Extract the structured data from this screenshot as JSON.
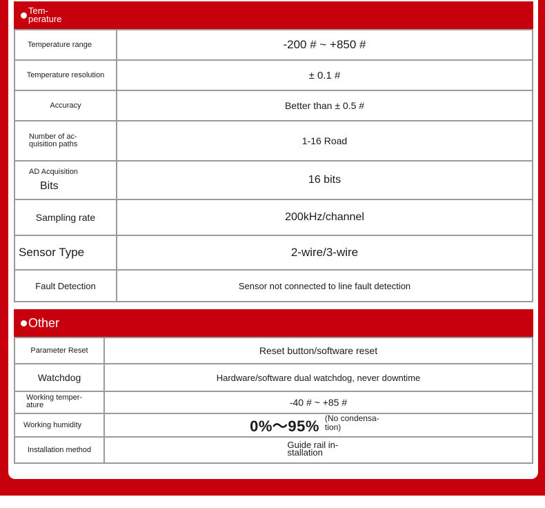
{
  "sections": {
    "temperature": {
      "title": "Tem-perature",
      "rows": [
        {
          "label": "Temperature range",
          "value": "-200 # ~ +850 #"
        },
        {
          "label": "Temperature resolution",
          "value": "± 0.1 #"
        },
        {
          "label": "Accuracy",
          "value": "Better than ± 0.5 #"
        },
        {
          "label": "Number of ac-quisition paths",
          "value": "1-16 Road"
        },
        {
          "label": "AD Acquisition",
          "label2": "Bits",
          "value": "16 bits"
        },
        {
          "label": "Sampling rate",
          "value": "200kHz/channel"
        },
        {
          "label": "Sensor Type",
          "value": "2-wire/3-wire"
        },
        {
          "label": "Fault Detection",
          "value": "Sensor not connected to line fault detection"
        }
      ]
    },
    "other": {
      "title": "Other",
      "rows": [
        {
          "label": "Parameter Reset",
          "value": "Reset button/software reset"
        },
        {
          "label": "Watchdog",
          "value": "Hardware/software dual watchdog, never downtime"
        },
        {
          "label": "Working temper-ature",
          "value": "-40 # ~ +85 #"
        },
        {
          "label": "Working humidity",
          "value": "0%～95%",
          "note": "(No condensa-tion)"
        },
        {
          "label": "Installation method",
          "value": "Guide rail in-stallation"
        }
      ]
    }
  },
  "colors": {
    "accent": "#c8000e",
    "border": "#9a9a9a"
  }
}
